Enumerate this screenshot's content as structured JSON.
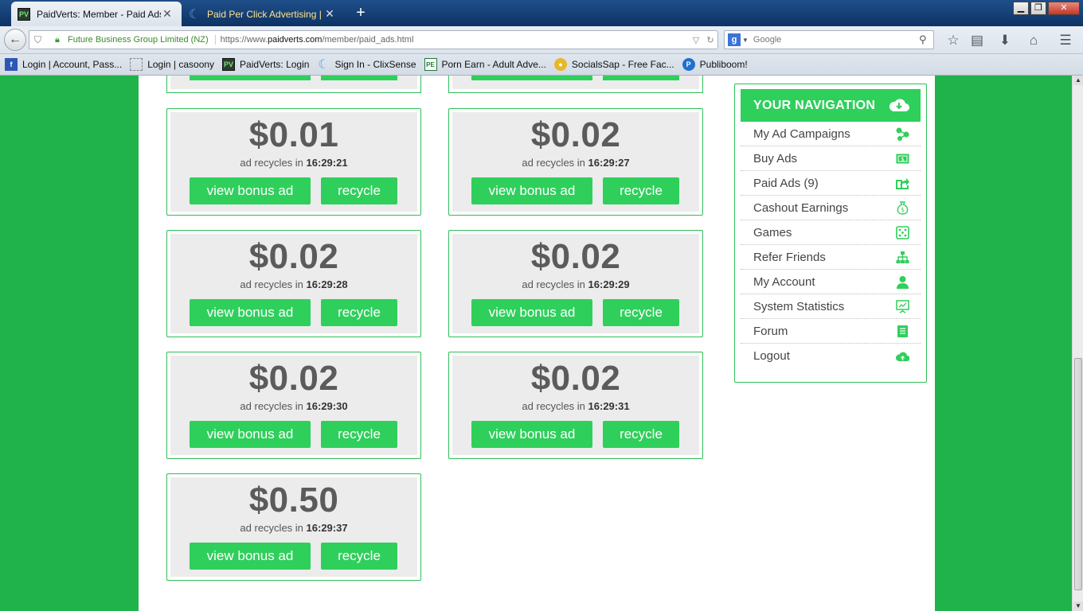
{
  "browser": {
    "tabs": [
      {
        "title": "PaidVerts: Member - Paid Ads",
        "favicon": "pv-icon",
        "active": true
      },
      {
        "title": "Paid Per Click Advertising | Pai...",
        "favicon": "clixsense-icon",
        "active": false
      }
    ],
    "url_identity": "Future Business Group Limited (NZ)",
    "url_prefix": "https://www.",
    "url_domain": "paidverts.com",
    "url_path": "/member/paid_ads.html",
    "search_placeholder": "Google",
    "bookmarks": [
      {
        "label": "Login | Account, Pass...",
        "icon": "facebook-icon"
      },
      {
        "label": "Login | casoony",
        "icon": "blank-page-icon"
      },
      {
        "label": "PaidVerts: Login",
        "icon": "pv-icon"
      },
      {
        "label": "Sign In - ClixSense",
        "icon": "clixsense-icon"
      },
      {
        "label": "Porn Earn - Adult Adve...",
        "icon": "pe-icon"
      },
      {
        "label": "SocialsSap - Free Fac...",
        "icon": "socialssap-icon"
      },
      {
        "label": "Publiboom!",
        "icon": "publiboom-icon"
      }
    ]
  },
  "ads": [
    {
      "amount": "$0.01",
      "recycle_prefix": "ad recycles in",
      "time": "16:29:21",
      "bonus_label": "view bonus ad",
      "recycle_label": "recycle"
    },
    {
      "amount": "$0.02",
      "recycle_prefix": "ad recycles in",
      "time": "16:29:27",
      "bonus_label": "view bonus ad",
      "recycle_label": "recycle"
    },
    {
      "amount": "$0.02",
      "recycle_prefix": "ad recycles in",
      "time": "16:29:28",
      "bonus_label": "view bonus ad",
      "recycle_label": "recycle"
    },
    {
      "amount": "$0.02",
      "recycle_prefix": "ad recycles in",
      "time": "16:29:29",
      "bonus_label": "view bonus ad",
      "recycle_label": "recycle"
    },
    {
      "amount": "$0.02",
      "recycle_prefix": "ad recycles in",
      "time": "16:29:30",
      "bonus_label": "view bonus ad",
      "recycle_label": "recycle"
    },
    {
      "amount": "$0.02",
      "recycle_prefix": "ad recycles in",
      "time": "16:29:31",
      "bonus_label": "view bonus ad",
      "recycle_label": "recycle"
    },
    {
      "amount": "$0.50",
      "recycle_prefix": "ad recycles in",
      "time": "16:29:37",
      "bonus_label": "view bonus ad",
      "recycle_label": "recycle"
    }
  ],
  "nav": {
    "title": "YOUR NAVIGATION",
    "items": [
      {
        "label": "My Ad Campaigns",
        "icon": "campaigns-icon"
      },
      {
        "label": "Buy Ads",
        "icon": "dollar-bill-icon"
      },
      {
        "label": "Paid Ads (9)",
        "icon": "share-icon"
      },
      {
        "label": "Cashout Earnings",
        "icon": "money-bag-icon"
      },
      {
        "label": "Games",
        "icon": "dice-icon"
      },
      {
        "label": "Refer Friends",
        "icon": "sitemap-icon"
      },
      {
        "label": "My Account",
        "icon": "user-icon"
      },
      {
        "label": "System Statistics",
        "icon": "presentation-icon"
      },
      {
        "label": "Forum",
        "icon": "book-icon"
      },
      {
        "label": "Logout",
        "icon": "cloud-upload-icon"
      }
    ]
  },
  "colors": {
    "brand_green": "#2fcf5c",
    "background_green": "#20b24b",
    "card_gray": "#ececec"
  }
}
